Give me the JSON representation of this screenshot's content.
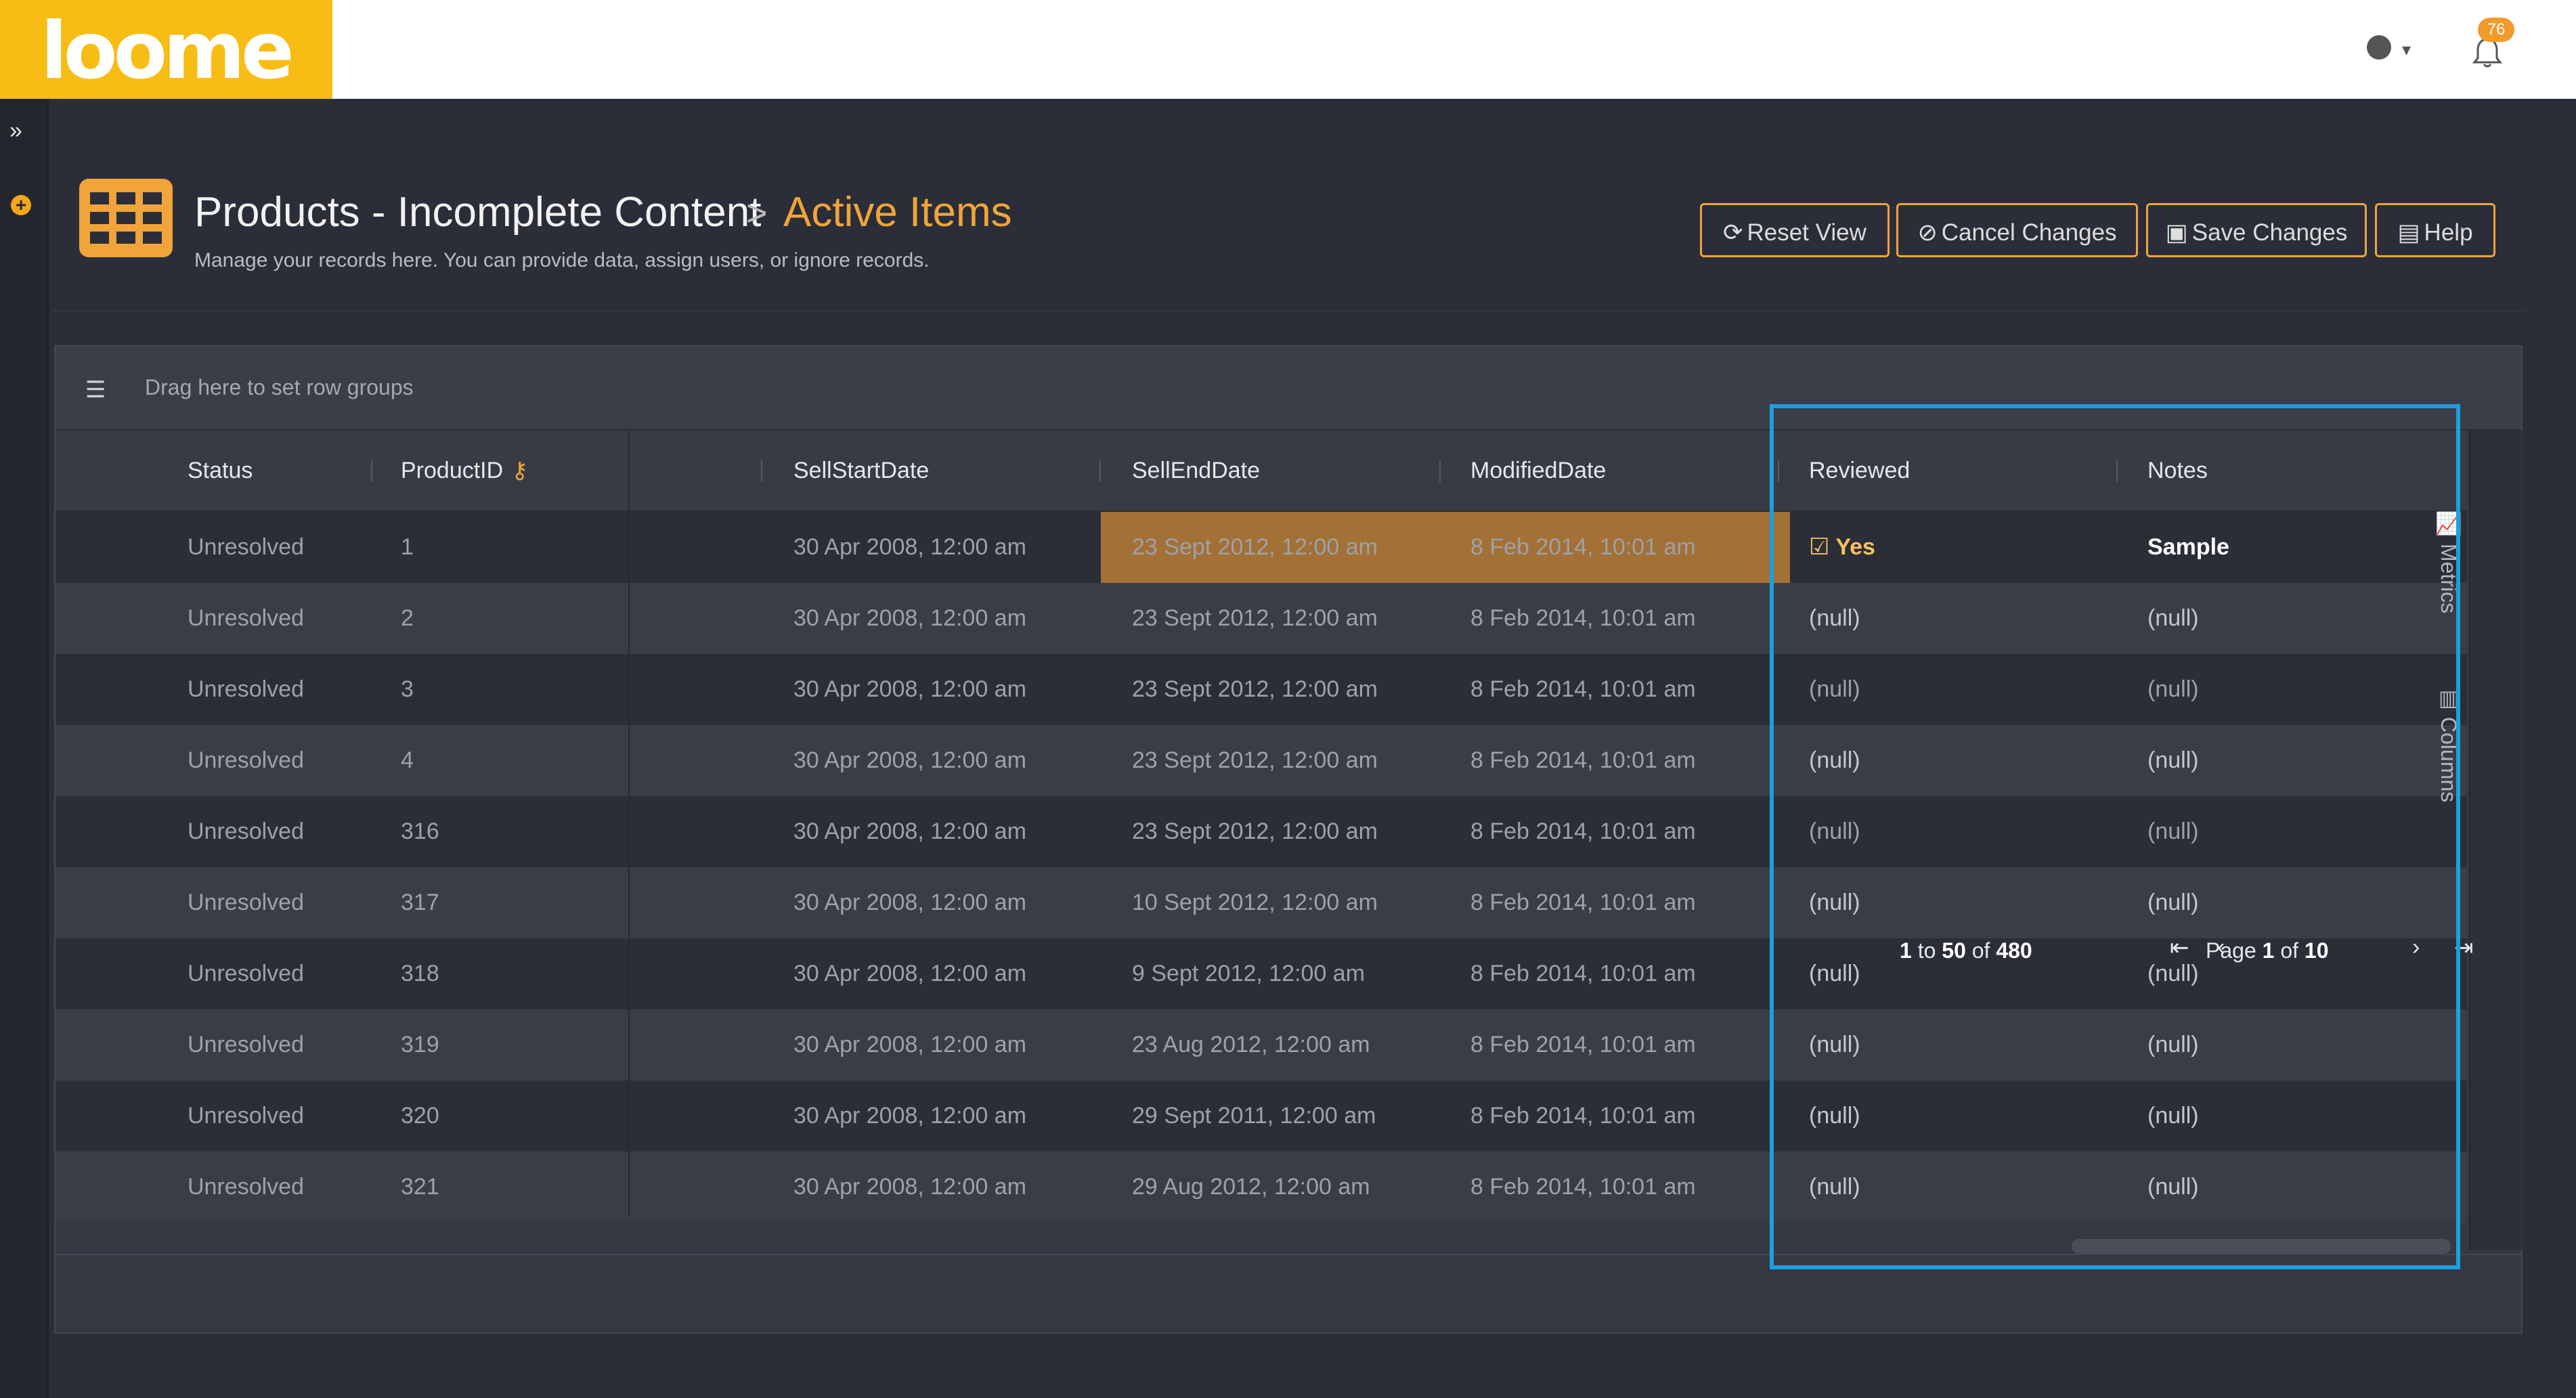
{
  "app": {
    "logo_text": "loome"
  },
  "topbar": {
    "globe_icon": "globe-icon",
    "notification_count": "76"
  },
  "header": {
    "title": "Products - Incomplete Content",
    "separator": ">",
    "subtitle_link": "Active Items",
    "description": "Manage your records here. You can provide data, assign users, or ignore records."
  },
  "toolbar": {
    "reset_label": "Reset View",
    "cancel_label": "Cancel Changes",
    "save_label": "Save Changes",
    "help_label": "Help"
  },
  "grid": {
    "group_hint": "Drag here to set row groups",
    "columns": {
      "status": "Status",
      "productid": "ProductID",
      "sellstart": "SellStartDate",
      "sellend": "SellEndDate",
      "modified": "ModifiedDate",
      "reviewed": "Reviewed",
      "notes": "Notes"
    },
    "rows": [
      {
        "status": "Unresolved",
        "productid": "1",
        "sellstart": "30 Apr 2008, 12:00 am",
        "sellend": "23 Sept 2012, 12:00 am",
        "modified": "8 Feb 2014, 10:01 am",
        "reviewed": "Yes",
        "notes": "Sample"
      },
      {
        "status": "Unresolved",
        "productid": "2",
        "sellstart": "30 Apr 2008, 12:00 am",
        "sellend": "23 Sept 2012, 12:00 am",
        "modified": "8 Feb 2014, 10:01 am",
        "reviewed": "(null)",
        "notes": "(null)"
      },
      {
        "status": "Unresolved",
        "productid": "3",
        "sellstart": "30 Apr 2008, 12:00 am",
        "sellend": "23 Sept 2012, 12:00 am",
        "modified": "8 Feb 2014, 10:01 am",
        "reviewed": "(null)",
        "notes": "(null)"
      },
      {
        "status": "Unresolved",
        "productid": "4",
        "sellstart": "30 Apr 2008, 12:00 am",
        "sellend": "23 Sept 2012, 12:00 am",
        "modified": "8 Feb 2014, 10:01 am",
        "reviewed": "(null)",
        "notes": "(null)"
      },
      {
        "status": "Unresolved",
        "productid": "316",
        "sellstart": "30 Apr 2008, 12:00 am",
        "sellend": "23 Sept 2012, 12:00 am",
        "modified": "8 Feb 2014, 10:01 am",
        "reviewed": "(null)",
        "notes": "(null)"
      },
      {
        "status": "Unresolved",
        "productid": "317",
        "sellstart": "30 Apr 2008, 12:00 am",
        "sellend": "10 Sept 2012, 12:00 am",
        "modified": "8 Feb 2014, 10:01 am",
        "reviewed": "(null)",
        "notes": "(null)"
      },
      {
        "status": "Unresolved",
        "productid": "318",
        "sellstart": "30 Apr 2008, 12:00 am",
        "sellend": "9 Sept 2012, 12:00 am",
        "modified": "8 Feb 2014, 10:01 am",
        "reviewed": "(null)",
        "notes": "(null)"
      },
      {
        "status": "Unresolved",
        "productid": "319",
        "sellstart": "30 Apr 2008, 12:00 am",
        "sellend": "23 Aug 2012, 12:00 am",
        "modified": "8 Feb 2014, 10:01 am",
        "reviewed": "(null)",
        "notes": "(null)"
      },
      {
        "status": "Unresolved",
        "productid": "320",
        "sellstart": "30 Apr 2008, 12:00 am",
        "sellend": "29 Sept 2011, 12:00 am",
        "modified": "8 Feb 2014, 10:01 am",
        "reviewed": "(null)",
        "notes": "(null)"
      },
      {
        "status": "Unresolved",
        "productid": "321",
        "sellstart": "30 Apr 2008, 12:00 am",
        "sellend": "29 Aug 2012, 12:00 am",
        "modified": "8 Feb 2014, 10:01 am",
        "reviewed": "(null)",
        "notes": "(null)"
      }
    ],
    "side_tools": {
      "metrics": "Metrics",
      "columns": "Columns"
    }
  },
  "pagination": {
    "from": "1",
    "to_word": "to",
    "to": "50",
    "of_word": "of",
    "total": "480",
    "page_word": "Page",
    "page": "1",
    "pages": "10"
  },
  "colors": {
    "accent": "#f0a43a",
    "highlight_row": "#a37036",
    "focus_outline": "#1aa0e0"
  }
}
